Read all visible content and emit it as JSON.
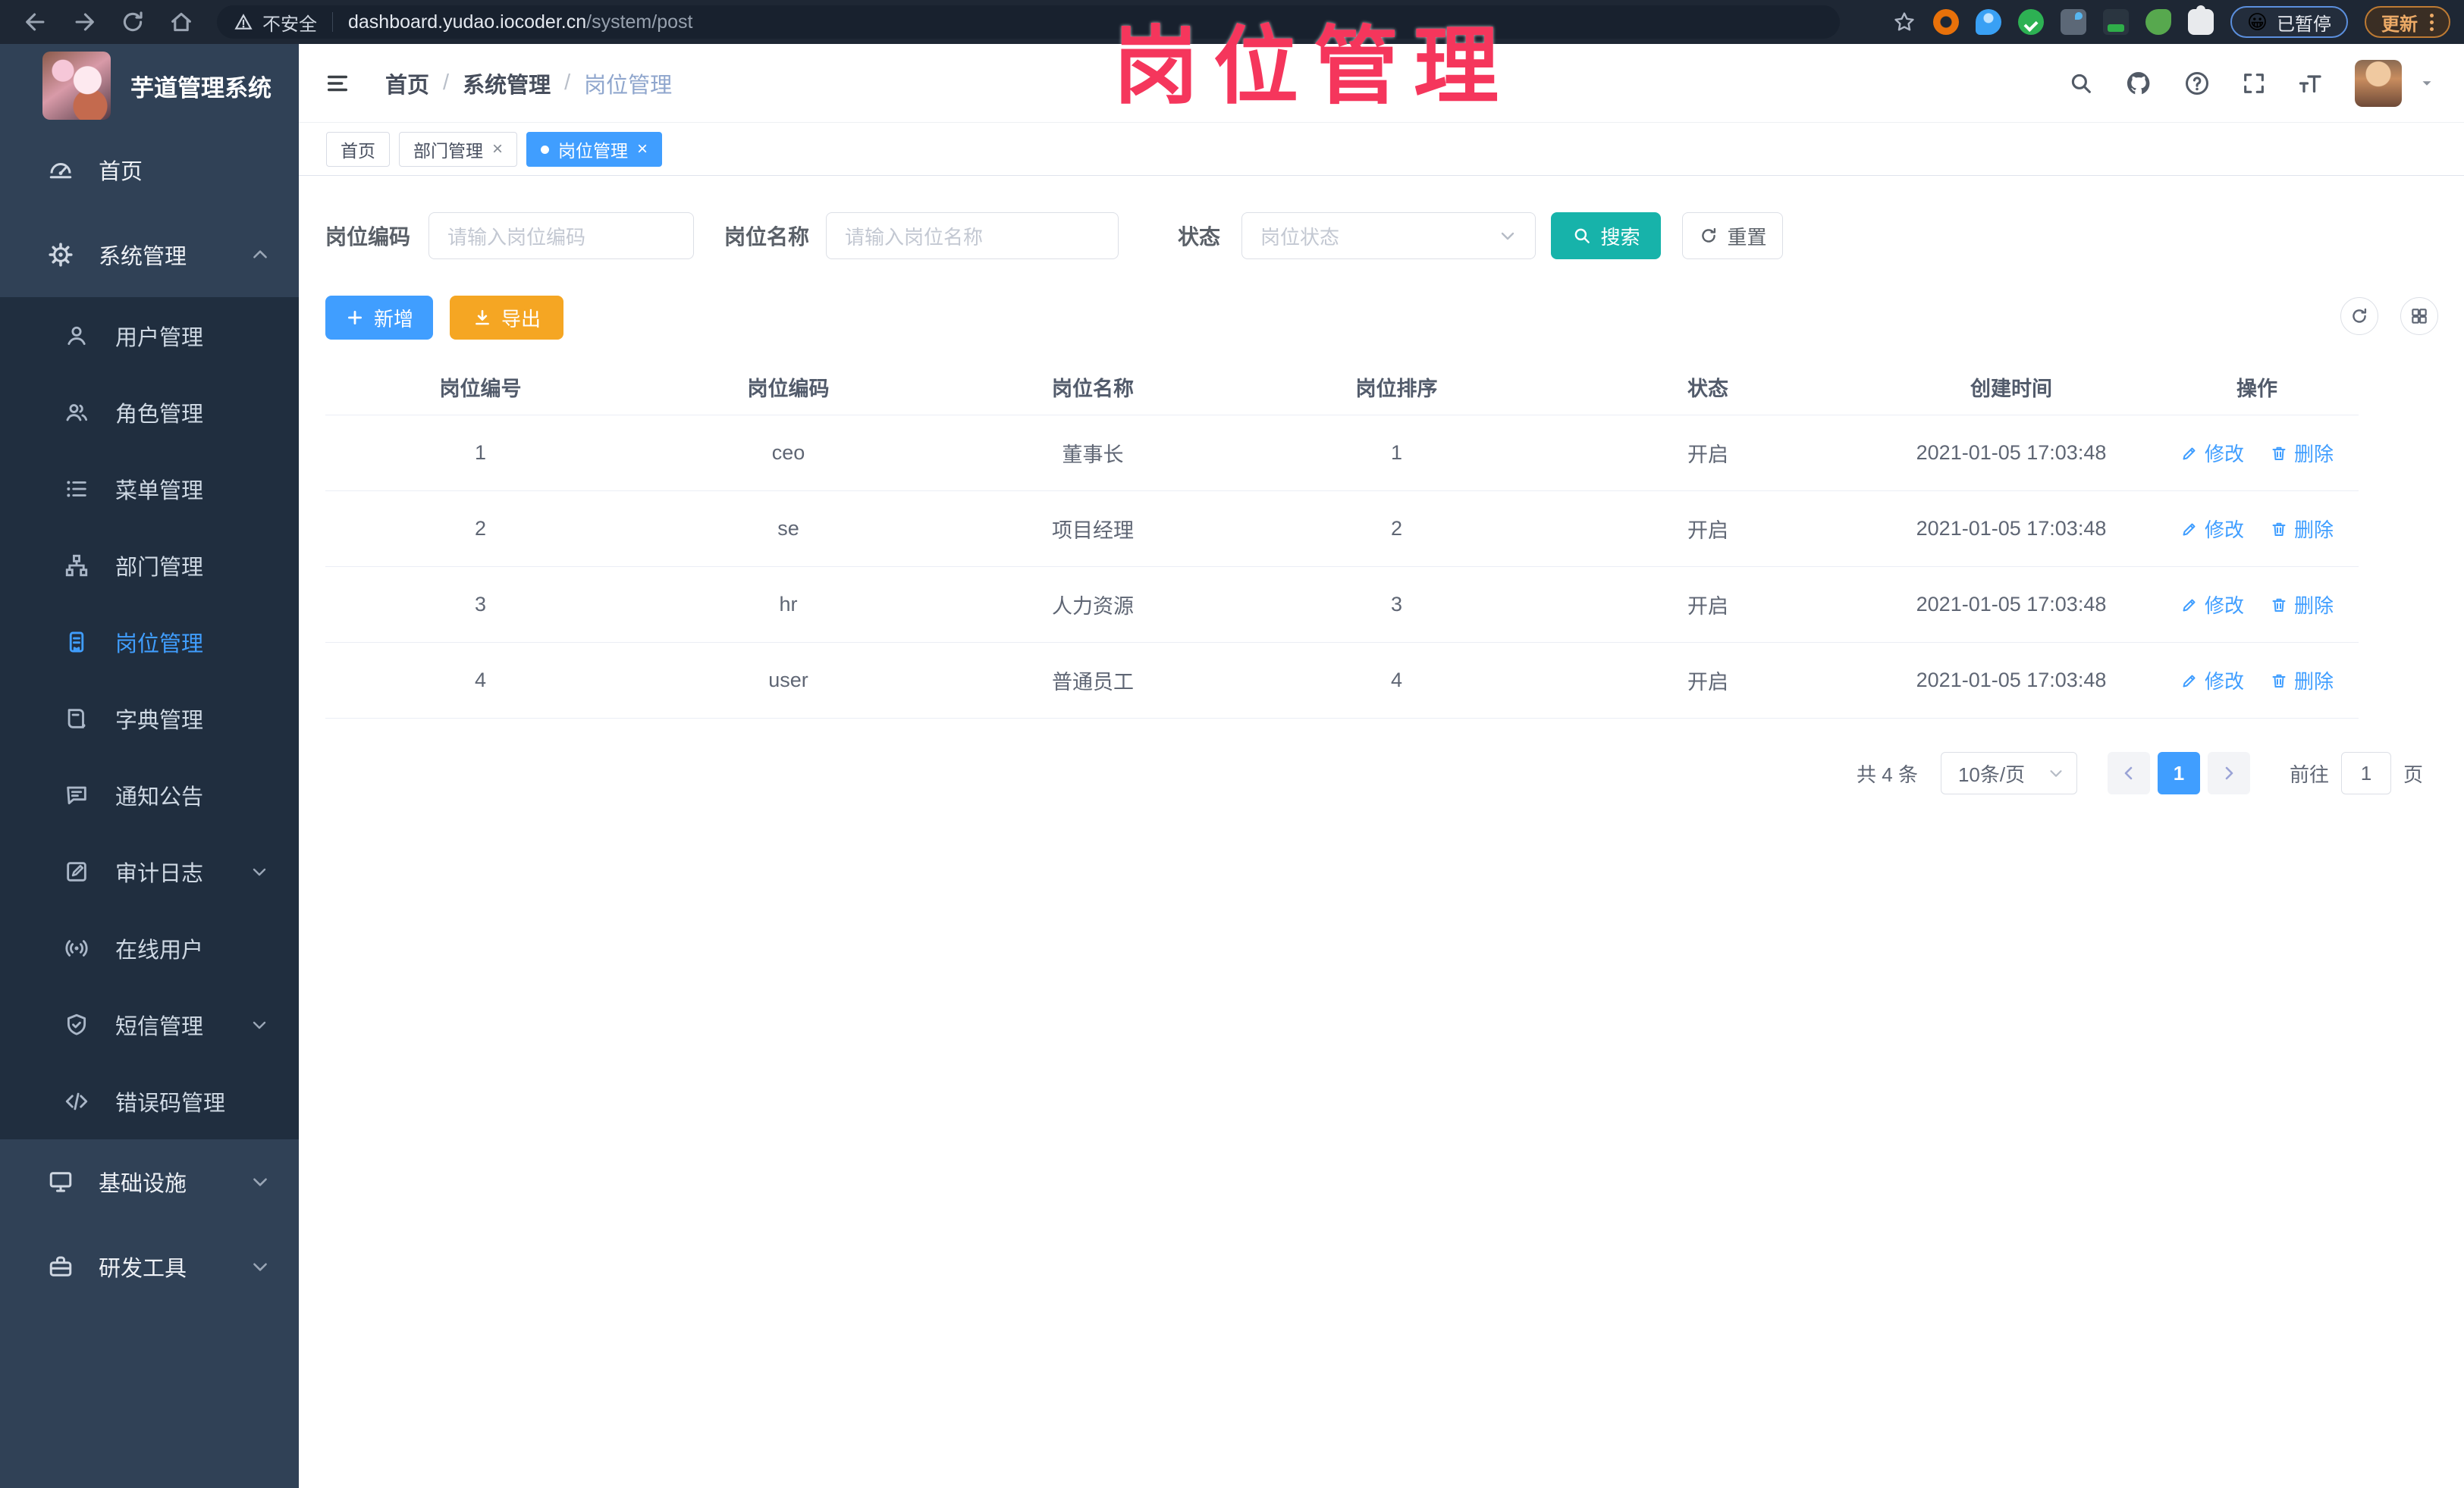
{
  "browser": {
    "security_label": "不安全",
    "url_host": "dashboard.yudao.iocoder.cn",
    "url_path": "/system/post",
    "paused_chip": "已暂停",
    "paused_emoji": "😀",
    "update_chip": "更新"
  },
  "overlay": {
    "title": "岗位管理"
  },
  "icons": {
    "close": "×"
  },
  "sidebar": {
    "app_title": "芋道管理系统",
    "top_items": [
      {
        "label": "首页"
      },
      {
        "label": "系统管理"
      }
    ],
    "sub_items": [
      {
        "label": "用户管理"
      },
      {
        "label": "角色管理"
      },
      {
        "label": "菜单管理"
      },
      {
        "label": "部门管理"
      },
      {
        "label": "岗位管理"
      },
      {
        "label": "字典管理"
      },
      {
        "label": "通知公告"
      },
      {
        "label": "审计日志"
      },
      {
        "label": "在线用户"
      },
      {
        "label": "短信管理"
      },
      {
        "label": "错误码管理"
      }
    ],
    "bottom_items": [
      {
        "label": "基础设施"
      },
      {
        "label": "研发工具"
      }
    ]
  },
  "header": {
    "breadcrumb": [
      "首页",
      "系统管理",
      "岗位管理"
    ],
    "separator": "/"
  },
  "tabs": [
    {
      "label": "首页"
    },
    {
      "label": "部门管理"
    },
    {
      "label": "岗位管理"
    }
  ],
  "filters": {
    "code_label": "岗位编码",
    "code_placeholder": "请输入岗位编码",
    "name_label": "岗位名称",
    "name_placeholder": "请输入岗位名称",
    "status_label": "状态",
    "status_placeholder": "岗位状态",
    "search_button": "搜索",
    "reset_button": "重置"
  },
  "toolbar": {
    "add_button": "新增",
    "export_button": "导出"
  },
  "table": {
    "headers": [
      "岗位编号",
      "岗位编码",
      "岗位名称",
      "岗位排序",
      "状态",
      "创建时间",
      "操作"
    ],
    "edit_label": "修改",
    "delete_label": "删除",
    "rows": [
      {
        "id": "1",
        "code": "ceo",
        "name": "董事长",
        "sort": "1",
        "status": "开启",
        "created": "2021-01-05 17:03:48"
      },
      {
        "id": "2",
        "code": "se",
        "name": "项目经理",
        "sort": "2",
        "status": "开启",
        "created": "2021-01-05 17:03:48"
      },
      {
        "id": "3",
        "code": "hr",
        "name": "人力资源",
        "sort": "3",
        "status": "开启",
        "created": "2021-01-05 17:03:48"
      },
      {
        "id": "4",
        "code": "user",
        "name": "普通员工",
        "sort": "4",
        "status": "开启",
        "created": "2021-01-05 17:03:48"
      }
    ]
  },
  "pagination": {
    "total": "共 4 条",
    "page_size": "10条/页",
    "current_page": "1",
    "goto_label": "前往",
    "goto_value": "1",
    "page_suffix": "页"
  },
  "colors": {
    "accent_blue": "#409eff",
    "search_teal": "#17b3aa",
    "export_orange": "#f5a623",
    "overlay_pink": "#f5365c",
    "sidebar_bg": "#304156",
    "submenu_bg": "#202e3f"
  }
}
